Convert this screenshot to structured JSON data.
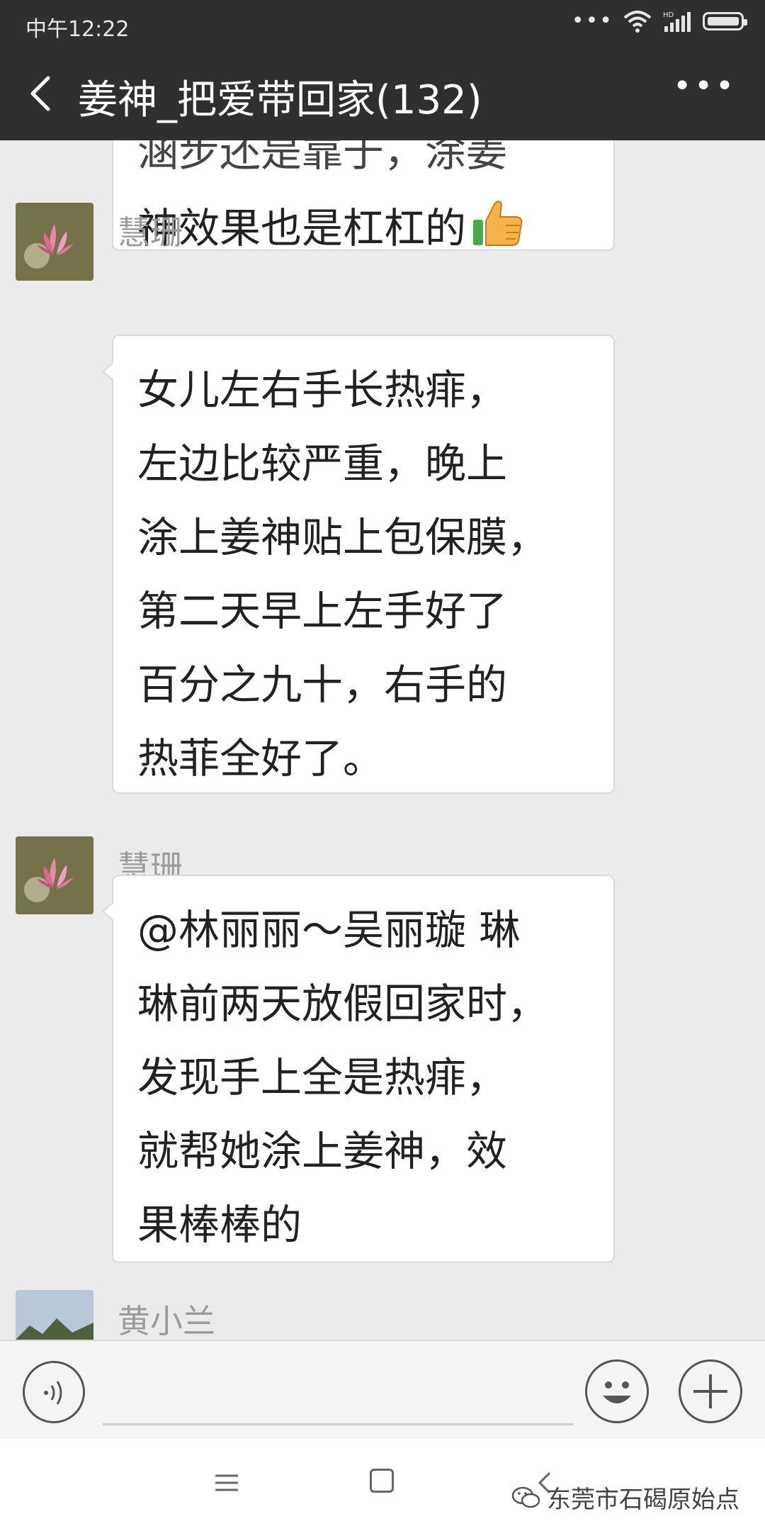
{
  "status_bar": {
    "time": "中午12:22",
    "more_dots": "•••",
    "icons": [
      "wifi-icon",
      "hd-signal-icon",
      "battery-icon"
    ]
  },
  "header": {
    "back_icon": "chevron-left-icon",
    "title": "姜神_把爱带回家(132)",
    "more_label": "•••"
  },
  "messages": [
    {
      "type": "continuation",
      "lines": [
        "涵步还是靠于，涂姜",
        "神效果也是杠杠的"
      ],
      "emoji": "thumbs-up-icon"
    },
    {
      "type": "message",
      "sender": "慧珊",
      "avatar": "lotus-flower-avatar",
      "lines": [
        "女儿左右手长热痱，",
        "左边比较严重，晚上",
        "涂上姜神贴上包保膜，",
        "第二天早上左手好了",
        "百分之九十，右手的",
        "热菲全好了。"
      ]
    },
    {
      "type": "message",
      "sender": "慧珊",
      "avatar": "lotus-flower-avatar",
      "lines": [
        "@林丽丽～吴丽璇  琳",
        "琳前两天放假回家时，",
        "发现手上全是热痱，",
        "就帮她涂上姜神，效",
        "果棒棒的"
      ]
    },
    {
      "type": "message",
      "sender": "黄小兰",
      "avatar": "mountain-avatar",
      "lines": []
    }
  ],
  "input_bar": {
    "voice_icon": "voice-icon",
    "emoji_icon": "smiley-icon",
    "plus_icon": "plus-icon"
  },
  "nav_bar": {
    "menu_icon": "menu-icon",
    "home_icon": "home-square-icon",
    "back_icon": "back-icon"
  },
  "watermark": {
    "text": "东莞市石碣原始点",
    "icon": "wechat-logo-icon"
  },
  "colors": {
    "header_bg": "#2f2f2f",
    "chat_bg": "#ebebeb",
    "bubble_bg": "#ffffff",
    "sender_text": "#9b9b9b"
  }
}
